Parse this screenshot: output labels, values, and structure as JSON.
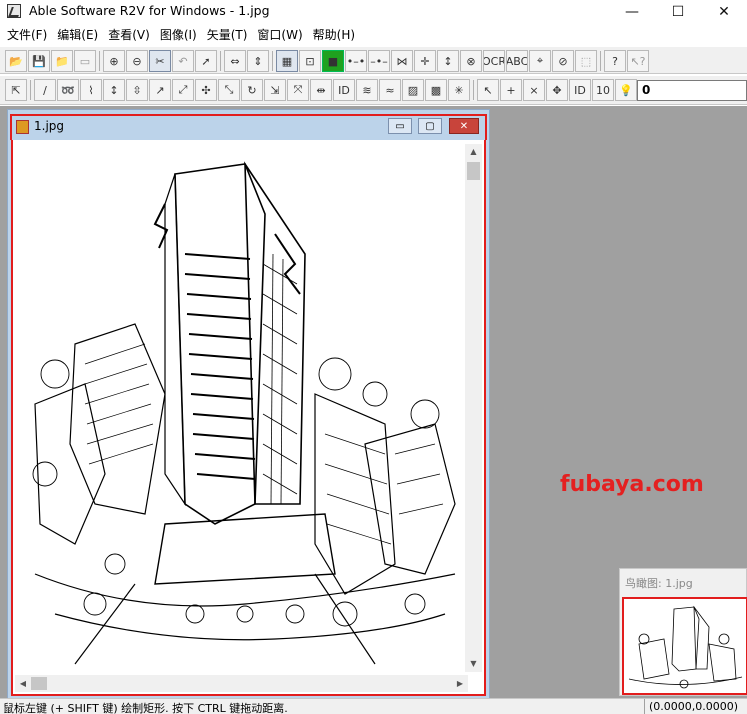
{
  "app": {
    "title": "Able Software R2V for Windows - 1.jpg",
    "window_controls": {
      "minimize": "—",
      "maximize": "☐",
      "close": "✕"
    }
  },
  "menu": [
    "文件(F)",
    "编辑(E)",
    "查看(V)",
    "图像(I)",
    "矢量(T)",
    "窗口(W)",
    "帮助(H)"
  ],
  "toolbar1": {
    "buttons": [
      {
        "name": "open-icon",
        "glyph": "📂"
      },
      {
        "name": "save-icon",
        "glyph": "💾"
      },
      {
        "name": "open-project-icon",
        "glyph": "📁"
      },
      {
        "name": "save-disabled-icon",
        "glyph": "▭"
      },
      {
        "name": "zoom-in-icon",
        "glyph": "⊕"
      },
      {
        "name": "zoom-out-icon",
        "glyph": "⊖"
      },
      {
        "name": "cut-line-icon",
        "glyph": "✂"
      },
      {
        "name": "undo-icon",
        "glyph": "↶"
      },
      {
        "name": "select-arrow-icon",
        "glyph": "➚"
      },
      {
        "name": "fit-width-icon",
        "glyph": "⇔"
      },
      {
        "name": "fit-page-icon",
        "glyph": "⇕"
      },
      {
        "name": "image-view-icon",
        "glyph": "▦"
      },
      {
        "name": "fit-window-icon",
        "glyph": "⊡"
      },
      {
        "name": "green-box-icon",
        "glyph": "■"
      },
      {
        "name": "node-link-icon",
        "glyph": "•–•"
      },
      {
        "name": "node-split-icon",
        "glyph": "–•–"
      },
      {
        "name": "vertex-chain-icon",
        "glyph": "⋈"
      },
      {
        "name": "cross-node-icon",
        "glyph": "✛"
      },
      {
        "name": "vertical-node-icon",
        "glyph": "↕"
      },
      {
        "name": "delete-node-icon",
        "glyph": "⊗"
      },
      {
        "name": "ocr-icon",
        "glyph": "OCR"
      },
      {
        "name": "abc-text-icon",
        "glyph": "ABC"
      },
      {
        "name": "target-icon",
        "glyph": "⌖"
      },
      {
        "name": "pick-icon",
        "glyph": "⊘"
      },
      {
        "name": "pointer-disabled-icon",
        "glyph": "⬚"
      },
      {
        "name": "help-icon",
        "glyph": "?"
      },
      {
        "name": "context-help-icon",
        "glyph": "↖?"
      }
    ]
  },
  "toolbar2": {
    "buttons": [
      {
        "name": "select-vector-icon",
        "glyph": "⇱"
      },
      {
        "name": "pen-line-icon",
        "glyph": "∕"
      },
      {
        "name": "lasso-icon",
        "glyph": "➿"
      },
      {
        "name": "polyline-icon",
        "glyph": "⌇"
      },
      {
        "name": "vertical-move-icon",
        "glyph": "↕"
      },
      {
        "name": "vertical-move-2-icon",
        "glyph": "⇳"
      },
      {
        "name": "diagonal-icon",
        "glyph": "↗"
      },
      {
        "name": "diagonal-2-icon",
        "glyph": "⤢"
      },
      {
        "name": "node-cross-icon",
        "glyph": "✣"
      },
      {
        "name": "break-icon",
        "glyph": "⤡"
      },
      {
        "name": "rotate-icon",
        "glyph": "↻"
      },
      {
        "name": "scale-icon",
        "glyph": "⇲"
      },
      {
        "name": "stretch-icon",
        "glyph": "⤧"
      },
      {
        "name": "join-icon",
        "glyph": "⇹"
      },
      {
        "name": "id-icon",
        "glyph": "ID"
      },
      {
        "name": "contour-icon",
        "glyph": "≋"
      },
      {
        "name": "contour-2-icon",
        "glyph": "≈"
      },
      {
        "name": "fill-icon",
        "glyph": "▨"
      },
      {
        "name": "polygon-icon",
        "glyph": "▩"
      },
      {
        "name": "sun-icon",
        "glyph": "✳"
      },
      {
        "name": "arrow-select-icon",
        "glyph": "↖"
      },
      {
        "name": "add-point-icon",
        "glyph": "+"
      },
      {
        "name": "delete-point-icon",
        "glyph": "×"
      },
      {
        "name": "move-point-icon",
        "glyph": "✥"
      },
      {
        "name": "point-id-icon",
        "glyph": "ID"
      },
      {
        "name": "point-value-icon",
        "glyph": "10"
      },
      {
        "name": "bulb-icon",
        "glyph": "💡"
      }
    ],
    "value_field": "0"
  },
  "document": {
    "title": "1.jpg",
    "buttons": {
      "minimize": "▭",
      "maximize": "▢",
      "close": "✕"
    }
  },
  "watermark": "fubaya.com",
  "overview": {
    "title": "鸟瞰图: 1.jpg"
  },
  "status": {
    "text": "鼠标左键 (+ SHIFT 键) 绘制矩形. 按下 CTRL 键拖动距离.",
    "coords": "(0.0000,0.0000)"
  },
  "colors": {
    "highlight": "#e21d1d",
    "watermark": "#e42020",
    "workspace": "#a0a0a0"
  }
}
